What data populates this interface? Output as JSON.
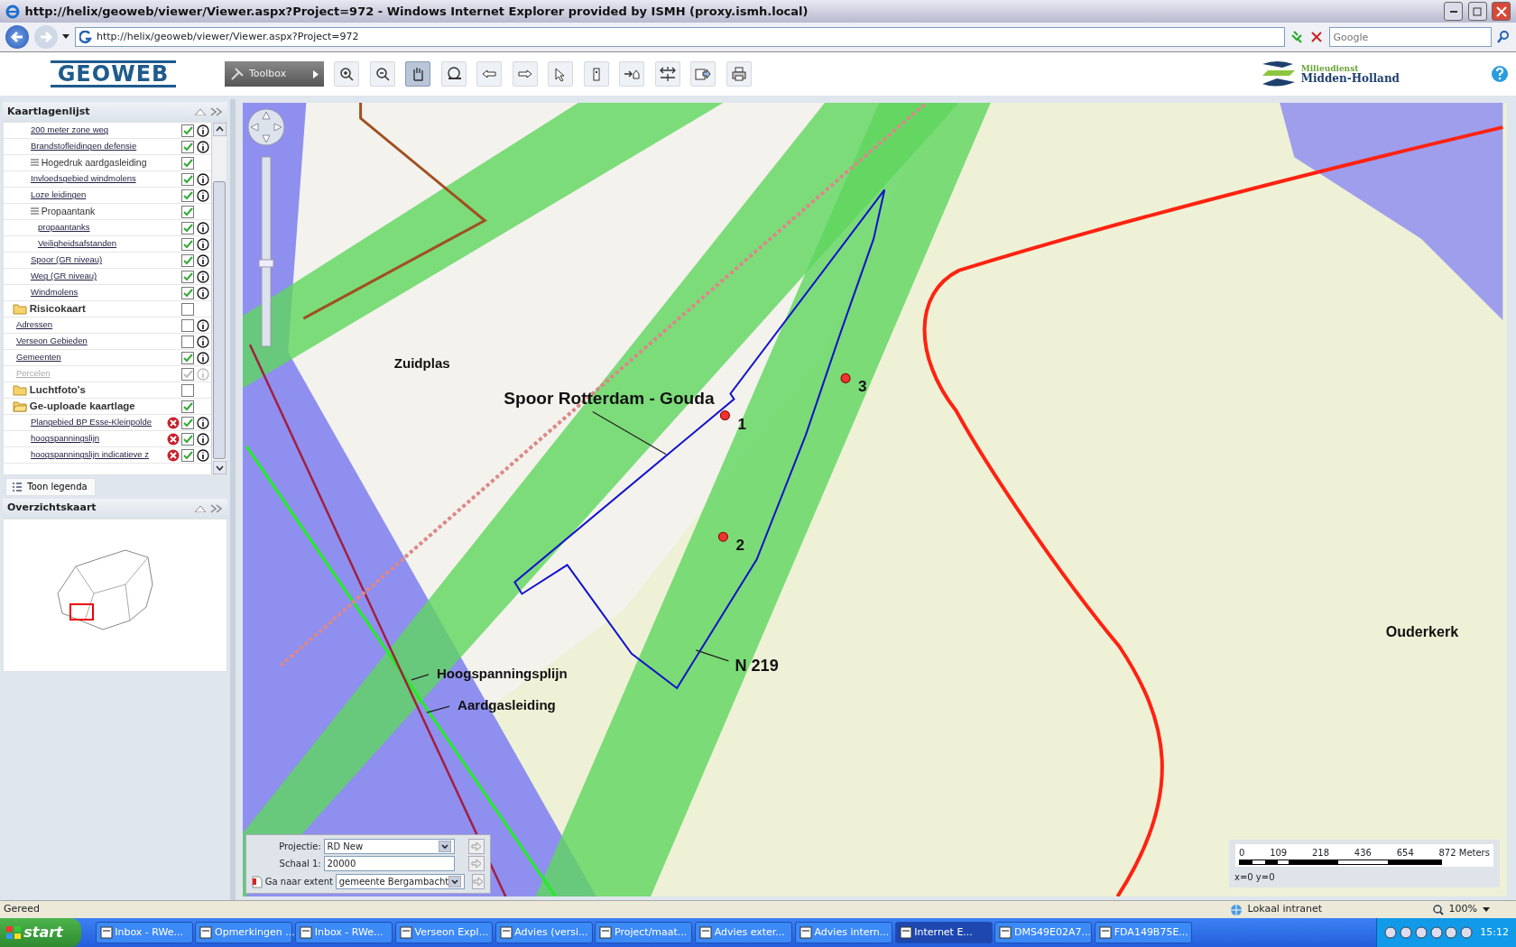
{
  "window": {
    "title": "http://helix/geoweb/viewer/Viewer.aspx?Project=972 - Windows Internet Explorer provided by ISMH (proxy.ismh.local)"
  },
  "address_bar": {
    "url": "http://helix/geoweb/viewer/Viewer.aspx?Project=972",
    "search_placeholder": "Google"
  },
  "app_header": {
    "logo": "GEOWEB",
    "toolbox_label": "Toolbox",
    "tools": [
      {
        "kind": "zoom-in",
        "selected": false
      },
      {
        "kind": "zoom-out",
        "selected": false
      },
      {
        "kind": "pan",
        "selected": true
      },
      {
        "kind": "zoom-extent",
        "selected": false
      },
      {
        "kind": "back",
        "selected": false
      },
      {
        "kind": "forward",
        "selected": false
      },
      {
        "kind": "select",
        "selected": false
      },
      {
        "kind": "identify",
        "selected": false
      },
      {
        "kind": "goto",
        "selected": false
      },
      {
        "kind": "measure",
        "selected": false
      },
      {
        "kind": "export",
        "selected": false
      },
      {
        "kind": "print",
        "selected": false
      }
    ],
    "org_logo_top": "Milieudienst",
    "org_logo_bottom": "Midden-Holland"
  },
  "layer_panel": {
    "title": "Kaartlagenlijst",
    "legend_button": "Toon legenda",
    "items": [
      {
        "kind": "layer",
        "label": "200 meter zone weg",
        "checked": true,
        "info": true
      },
      {
        "kind": "layer",
        "label": "Brandstofleidingen defensie",
        "checked": true,
        "info": true
      },
      {
        "kind": "group",
        "label": "Hogedruk aardgasleiding",
        "checked": true
      },
      {
        "kind": "layer",
        "label": "Invloedsgebied windmolens",
        "checked": true,
        "info": true
      },
      {
        "kind": "layer",
        "label": "Loze leidingen",
        "checked": true,
        "info": true
      },
      {
        "kind": "group",
        "label": "Propaantank",
        "checked": true,
        "children": [
          {
            "kind": "layer",
            "label": "propaantanks",
            "checked": true,
            "info": true
          },
          {
            "kind": "layer",
            "label": "Veiligheidsafstanden",
            "checked": true,
            "info": true
          }
        ]
      },
      {
        "kind": "layer",
        "label": "Spoor (GR niveau)",
        "checked": true,
        "info": true
      },
      {
        "kind": "layer",
        "label": "Weg (GR niveau)",
        "checked": true,
        "info": true
      },
      {
        "kind": "layer",
        "label": "Windmolens",
        "checked": true,
        "info": true
      },
      {
        "kind": "folder",
        "label": "Risicokaart",
        "checked": false,
        "expanded": false,
        "children": [
          {
            "kind": "layer",
            "label": "Adressen",
            "checked": false,
            "info": true
          },
          {
            "kind": "layer",
            "label": "Verseon Gebieden",
            "checked": false,
            "info": true
          },
          {
            "kind": "layer",
            "label": "Gemeenten",
            "checked": true,
            "info": true
          },
          {
            "kind": "layer",
            "label": "Percelen",
            "checked": true,
            "info": true,
            "disabled": true
          }
        ]
      },
      {
        "kind": "folder",
        "label": "Luchtfoto's",
        "checked": false,
        "expanded": false
      },
      {
        "kind": "folder",
        "label": "Ge-uploade kaartlage",
        "checked": true,
        "expanded": true,
        "children": [
          {
            "kind": "layer",
            "label": "Plangebied BP Esse-Kleinpolde",
            "checked": true,
            "info": true,
            "removable": true
          },
          {
            "kind": "layer",
            "label": "hoogspanningslijn",
            "checked": true,
            "info": true,
            "removable": true
          },
          {
            "kind": "layer",
            "label": "hoogspanningslijn indicatieve z",
            "checked": true,
            "info": true,
            "removable": true
          }
        ]
      }
    ]
  },
  "overview_panel": {
    "title": "Overzichtskaart"
  },
  "map": {
    "labels": [
      {
        "kind": "place",
        "text": "Zuidplas"
      },
      {
        "kind": "feature",
        "text": "Spoor Rotterdam - Gouda"
      },
      {
        "kind": "point",
        "text": "1"
      },
      {
        "kind": "point",
        "text": "2"
      },
      {
        "kind": "point",
        "text": "3"
      },
      {
        "kind": "feature",
        "text": "N 219"
      },
      {
        "kind": "feature",
        "text": "Hoogspanningsplijn"
      },
      {
        "kind": "feature",
        "text": "Aardgasleiding"
      },
      {
        "kind": "place",
        "text": "Ouderkerk"
      }
    ],
    "controls": {
      "projection_label": "Projectie:",
      "projection": "RD New",
      "scale_label": "Schaal 1:",
      "scale": "20000",
      "extent_label": "Ga naar extent",
      "extent": "gemeente Bergambacht"
    },
    "scale_bar": {
      "ticks": [
        "0",
        "109",
        "218",
        "436",
        "654",
        "872 Meters"
      ],
      "coords": "x=0 y=0"
    }
  },
  "status_bar": {
    "text": "Gereed",
    "zone": "Lokaal intranet",
    "zoom": "100%"
  },
  "taskbar": {
    "start": "start",
    "clock": "15:12",
    "items": [
      {
        "label": "Inbox - RWe...",
        "selected": false
      },
      {
        "label": "Opmerkingen ...",
        "selected": false
      },
      {
        "label": "Inbox - RWe...",
        "selected": false
      },
      {
        "label": "Verseon Expl...",
        "selected": false
      },
      {
        "label": "Advies (versi...",
        "selected": false
      },
      {
        "label": "Project/maat...",
        "selected": false
      },
      {
        "label": "Advies exter...",
        "selected": false
      },
      {
        "label": "Advies intern...",
        "selected": false
      },
      {
        "label": "Internet E...",
        "selected": true
      },
      {
        "label": "DMS49E02A7...",
        "selected": false
      },
      {
        "label": "FDA149B75E...",
        "selected": false
      }
    ]
  }
}
